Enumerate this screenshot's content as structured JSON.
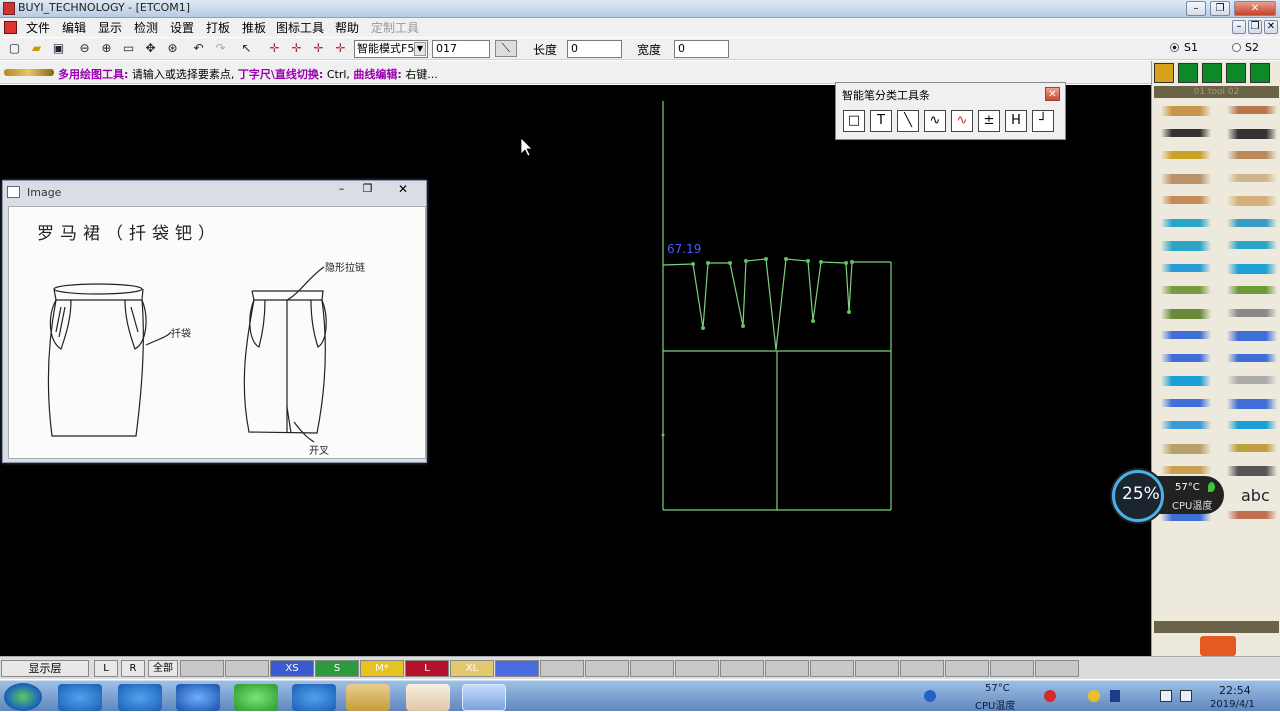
{
  "app": {
    "title": "BUYI_TECHNOLOGY - [ETCOM1]"
  },
  "menu": [
    "文件",
    "编辑",
    "显示",
    "检测",
    "设置",
    "打板",
    "推板",
    "图标工具",
    "帮助",
    "定制工具"
  ],
  "toolbar": {
    "mode_select": "智能模式F5",
    "number_field": "017",
    "length_label": "长度",
    "length_value": "0",
    "width_label": "宽度",
    "width_value": "0",
    "s1": "S1",
    "s2": "S2"
  },
  "hint": {
    "tool_name": "多用绘图工具:",
    "text1": "请输入或选择要素点,",
    "tkey1": "丁字尺\\直线切换:",
    "text2": "Ctrl,",
    "tkey2": "曲线编辑:",
    "text3": "右键..."
  },
  "image_window": {
    "title": "Image",
    "heading": "罗马裙（扦袋钯）",
    "note_pocket": "扦袋",
    "note_dart": "隐形拉链",
    "note_slit": "开叉"
  },
  "canvas": {
    "measure": "67.19"
  },
  "palette": {
    "title": "智能笔分类工具条",
    "buttons": [
      "rect-tool",
      "text-tool",
      "line-tool",
      "curve-tool",
      "bezier-tool",
      "parallel-tool",
      "h-tool",
      "angle-tool"
    ]
  },
  "statusbar": {
    "layer_button": "显示层",
    "l": "L",
    "r": "R",
    "all": "全部",
    "sizes": [
      {
        "name": "XS",
        "color": "#3c5bd1"
      },
      {
        "name": "S",
        "color": "#2e9a3e"
      },
      {
        "name": "M*",
        "color": "#e7c31f"
      },
      {
        "name": "L",
        "color": "#b4102c"
      },
      {
        "name": "XL",
        "color": "#e3c86c"
      },
      {
        "name": "",
        "color": "#4b6be0"
      }
    ]
  },
  "cpu": {
    "usage": "25%",
    "temp": "57°C",
    "label": "CPU温度"
  },
  "tray": {
    "temp": "57°C",
    "label": "CPU温度",
    "time": "22:54",
    "date": "2019/4/1"
  },
  "rightpanel": {
    "abc": "abc",
    "tabs": "01 tool 02"
  },
  "colors": {
    "canvas": "#000000",
    "pattern": "#7fd07f",
    "measure": "#4a5cff"
  }
}
